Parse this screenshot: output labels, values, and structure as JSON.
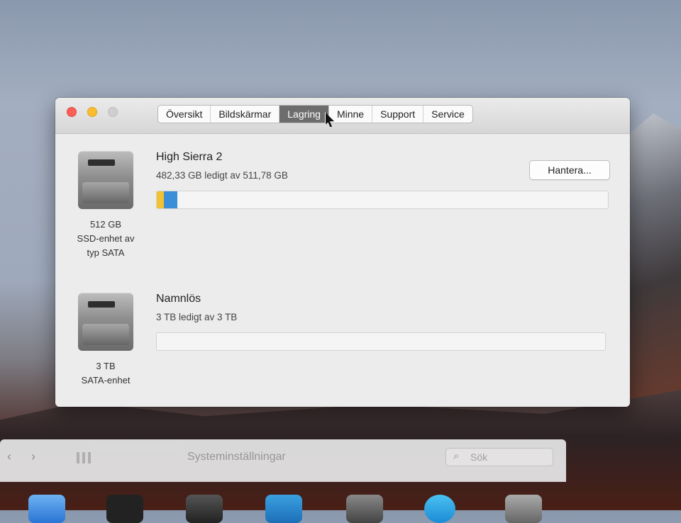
{
  "window": {
    "tabs": [
      {
        "label": "Översikt",
        "active": false
      },
      {
        "label": "Bildskärmar",
        "active": false
      },
      {
        "label": "Lagring",
        "active": true
      },
      {
        "label": "Minne",
        "active": false
      },
      {
        "label": "Support",
        "active": false
      },
      {
        "label": "Service",
        "active": false
      }
    ]
  },
  "drives": [
    {
      "icon": "internal-drive-icon",
      "caption": [
        "512 GB",
        "SSD-enhet av",
        "typ SATA"
      ],
      "volume_name": "High Sierra 2",
      "free_text": "482,33 GB ledigt av 511,78 GB",
      "manage_label": "Hantera...",
      "usage_segments": [
        {
          "color": "#f2c230",
          "fraction": 0.016
        },
        {
          "color": "#3b8ed8",
          "fraction": 0.03
        }
      ]
    },
    {
      "icon": "internal-drive-icon",
      "caption": [
        "3 TB",
        "SATA-enhet"
      ],
      "volume_name": "Namnlös",
      "free_text": "3 TB ledigt av 3 TB",
      "usage_segments": []
    }
  ],
  "background_window": {
    "title": "Systeminställningar",
    "search_placeholder": "Sök",
    "back_label": "‹",
    "forward_label": "›"
  }
}
